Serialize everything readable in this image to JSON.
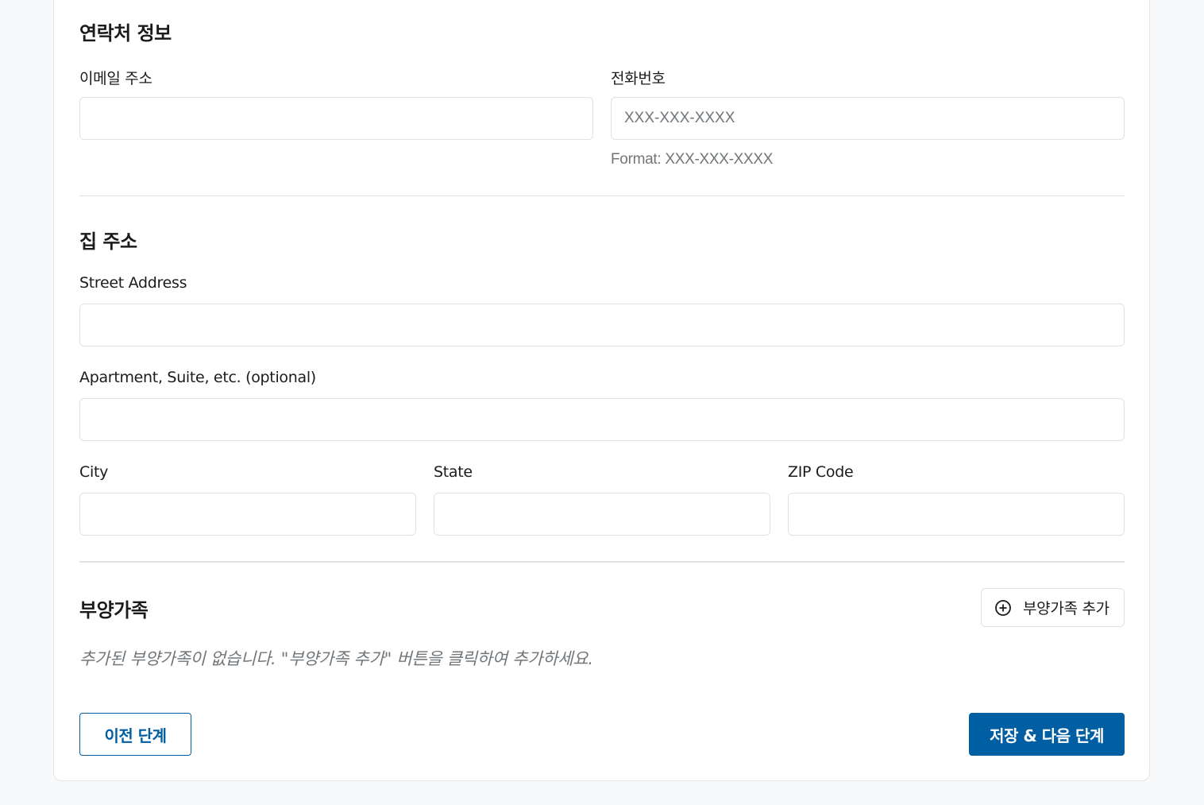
{
  "contact": {
    "title": "연락처 정보",
    "email_label": "이메일 주소",
    "email_value": "",
    "phone_label": "전화번호",
    "phone_placeholder": "XXX-XXX-XXXX",
    "phone_hint": "Format: XXX-XXX-XXXX"
  },
  "address": {
    "title": "집 주소",
    "street_label": "Street Address",
    "apt_label": "Apartment, Suite, etc. (optional)",
    "city_label": "City",
    "state_label": "State",
    "zip_label": "ZIP Code"
  },
  "dependents": {
    "title": "부양가족",
    "add_button_label": "부양가족 추가",
    "add_icon": "plus-circle-icon",
    "empty_message": "추가된 부양가족이 없습니다. \"부양가족 추가\" 버튼을 클릭하여 추가하세요."
  },
  "footer": {
    "prev_label": "이전 단계",
    "next_label": "저장 & 다음 단계"
  },
  "colors": {
    "primary": "#005ea2",
    "border": "#dfe1e2",
    "muted_text": "#71767a"
  }
}
